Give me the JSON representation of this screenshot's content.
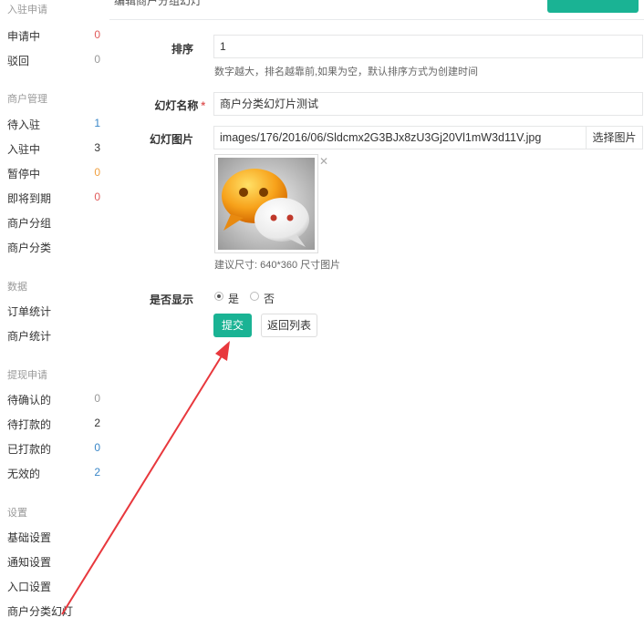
{
  "sidebar": {
    "sections": [
      {
        "title": "入驻申请",
        "items": [
          {
            "label": "申请中",
            "count": "0",
            "color": "#e05a5a"
          },
          {
            "label": "驳回",
            "count": "0",
            "color": "#999999"
          }
        ]
      },
      {
        "title": "商户管理",
        "items": [
          {
            "label": "待入驻",
            "count": "1",
            "color": "#3a87c8"
          },
          {
            "label": "入驻中",
            "count": "3",
            "color": "#333333"
          },
          {
            "label": "暂停中",
            "count": "0",
            "color": "#f0a040"
          },
          {
            "label": "即将到期",
            "count": "0",
            "color": "#e05a5a"
          },
          {
            "label": "商户分组",
            "count": "",
            "color": ""
          },
          {
            "label": "商户分类",
            "count": "",
            "color": ""
          }
        ]
      },
      {
        "title": "数据",
        "items": [
          {
            "label": "订单统计",
            "count": "",
            "color": ""
          },
          {
            "label": "商户统计",
            "count": "",
            "color": ""
          }
        ]
      },
      {
        "title": "提现申请",
        "items": [
          {
            "label": "待确认的",
            "count": "0",
            "color": "#999999"
          },
          {
            "label": "待打款的",
            "count": "2",
            "color": "#333333"
          },
          {
            "label": "已打款的",
            "count": "0",
            "color": "#3a87c8"
          },
          {
            "label": "无效的",
            "count": "2",
            "color": "#3a87c8"
          }
        ]
      },
      {
        "title": "设置",
        "items": [
          {
            "label": "基础设置",
            "count": "",
            "color": ""
          },
          {
            "label": "通知设置",
            "count": "",
            "color": ""
          },
          {
            "label": "入口设置",
            "count": "",
            "color": ""
          },
          {
            "label": "商户分类幻灯",
            "count": "",
            "color": ""
          }
        ]
      }
    ]
  },
  "header": {
    "title": "编辑商户分组幻灯"
  },
  "form": {
    "sort": {
      "label": "排序",
      "value": "1",
      "help": "数字越大，排名越靠前,如果为空，默认排序方式为创建时间"
    },
    "name": {
      "label": "幻灯名称",
      "required": "*",
      "value": "商户分类幻灯片测试"
    },
    "image": {
      "label": "幻灯图片",
      "value": "images/176/2016/06/Sldcmx2G3BJx8zU3Gj20Vl1mW3d11V.jpg",
      "select_button": "选择图片",
      "close": "✕",
      "hint": "建议尺寸: 640*360 尺寸图片"
    },
    "display": {
      "label": "是否显示",
      "options": [
        {
          "label": "是",
          "selected": true
        },
        {
          "label": "否",
          "selected": false
        }
      ]
    },
    "submit_label": "提交",
    "back_label": "返回列表"
  },
  "colors": {
    "accent": "#1ab394",
    "arrow": "#e8383d"
  }
}
